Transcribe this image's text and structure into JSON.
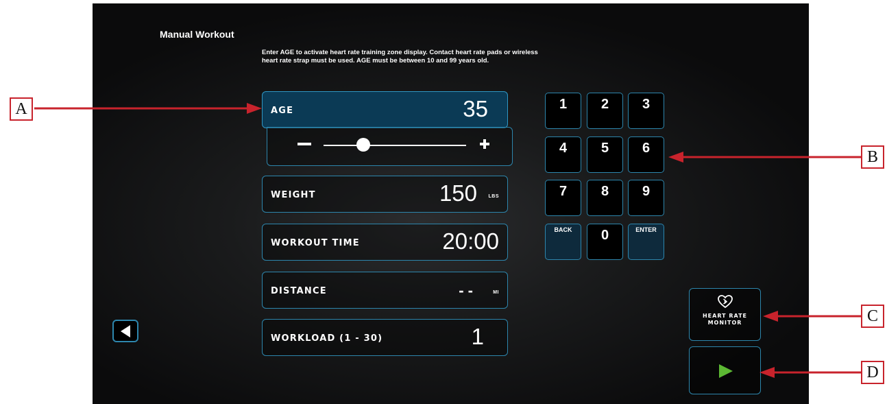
{
  "header": {
    "title": "Manual Workout",
    "instructions": "Enter AGE to activate heart rate training zone display.  Contact heart rate pads or wireless heart rate strap must be used. AGE must be between 10 and 99 years old."
  },
  "fields": {
    "age": {
      "label": "AGE",
      "value": "35"
    },
    "weight": {
      "label": "WEIGHT",
      "value": "150",
      "unit": "LBS"
    },
    "workout_time": {
      "label": "WORKOUT TIME",
      "value": "20:00"
    },
    "distance": {
      "label": "DISTANCE",
      "value": "- -",
      "unit": "MI"
    },
    "workload": {
      "label": "WORKLOAD (1 - 30)",
      "value": "1"
    }
  },
  "age_slider": {
    "min": 10,
    "max": 99,
    "value": 35,
    "minus_icon": "minus-icon",
    "plus_icon": "plus-icon"
  },
  "keypad": {
    "k1": "1",
    "k2": "2",
    "k3": "3",
    "k4": "4",
    "k5": "5",
    "k6": "6",
    "k7": "7",
    "k8": "8",
    "k9": "9",
    "back": "BACK",
    "k0": "0",
    "enter": "ENTER"
  },
  "heart_rate_button": {
    "label": "HEART RATE\nMONITOR",
    "icon": "heart-rate-icon"
  },
  "start_button": {
    "icon": "play-icon"
  },
  "back_button": {
    "icon": "back-arrow-icon"
  },
  "callouts": {
    "a": "A",
    "b": "B",
    "c": "C",
    "d": "D"
  },
  "colors": {
    "accent_border": "#2d86ad",
    "active_field": "#0b3a55",
    "start_icon": "#5cb833",
    "callout_red": "#c8232c"
  }
}
